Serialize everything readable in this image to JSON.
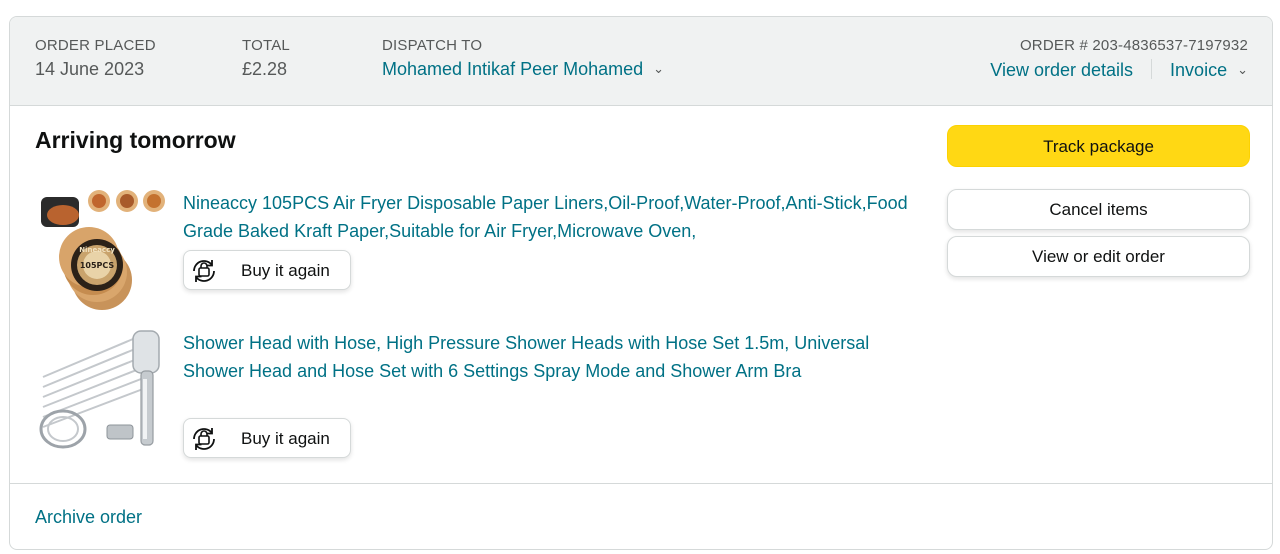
{
  "header": {
    "order_placed_label": "ORDER PLACED",
    "order_placed_value": "14 June 2023",
    "total_label": "TOTAL",
    "total_value": "£2.28",
    "dispatch_label": "DISPATCH TO",
    "dispatch_value": "Mohamed Intikaf Peer Mohamed",
    "order_number": "ORDER # 203-4836537-7197932",
    "view_order_details": "View order details",
    "invoice": "Invoice"
  },
  "shipment": {
    "status": "Arriving tomorrow",
    "track_button": "Track package",
    "cancel_button": "Cancel items",
    "edit_button": "View or edit order"
  },
  "items": [
    {
      "title": "Nineaccy 105PCS Air Fryer Disposable Paper Liners,Oil-Proof,Water-Proof,Anti-Stick,Food Grade Baked Kraft Paper,Suitable for Air Fryer,Microwave Oven,",
      "buy_again": "Buy it again",
      "image_icon": "air-fryer-liners-image",
      "image_brand": "Nineaccy",
      "image_count": "105PCS"
    },
    {
      "title": "Shower Head with Hose, High Pressure Shower Heads with Hose Set 1.5m, Universal Shower Head and Hose Set with 6 Settings Spray Mode and Shower Arm Bra",
      "buy_again": "Buy it again",
      "image_icon": "shower-head-image"
    }
  ],
  "footer": {
    "archive": "Archive order"
  },
  "colors": {
    "link": "#007185",
    "track_button": "#FFD814",
    "header_bg": "#F0F2F2"
  }
}
